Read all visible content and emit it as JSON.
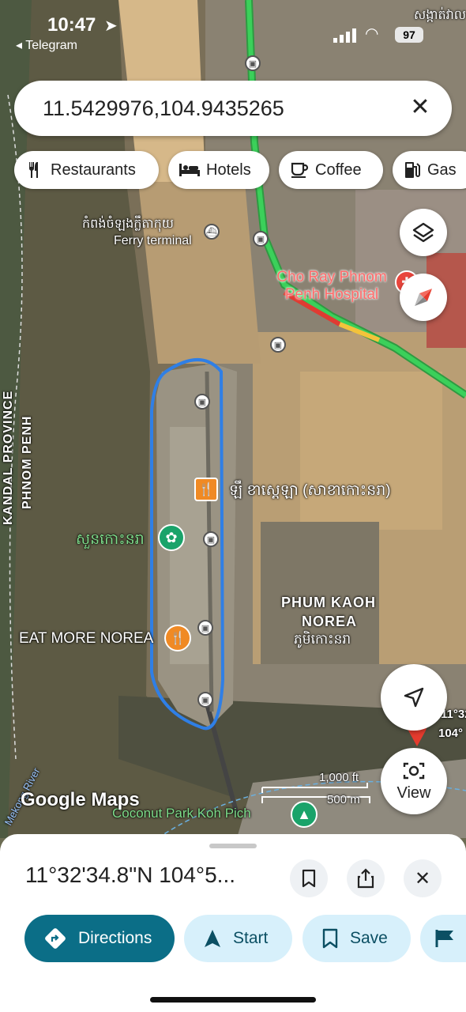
{
  "status_bar": {
    "time": "10:47",
    "back_app": "◂ Telegram",
    "battery": "97",
    "top_right_label": "សង្កាត់វាល"
  },
  "search": {
    "query": "11.5429976,104.9435265"
  },
  "chips": [
    {
      "label": "Restaurants",
      "icon": "fork-knife-icon"
    },
    {
      "label": "Hotels",
      "icon": "bed-icon"
    },
    {
      "label": "Coffee",
      "icon": "coffee-cup-icon"
    },
    {
      "label": "Gas",
      "icon": "gas-pump-icon"
    }
  ],
  "map_labels": {
    "ferry_kh": "កំពង់ចំឡងក្លឹតាកុយ",
    "ferry": "Ferry terminal",
    "hospital": "Cho Ray Phnom Penh Hospital",
    "restaurant_kh": "ឡឹ ខាស្តេឡា (សាខាកោះនរា)",
    "park_kh": "សួនកោះនរា",
    "eat_more": "EAT MORE NOREA",
    "phum_line1": "PHUM KAOH",
    "phum_line2": "NOREA",
    "phum_kh": "ភូមិកោះនរា",
    "province_line1": "KANDAL PROVINCE",
    "province_line2": "PHNOM PENH",
    "river": "Mekong River",
    "coconut_park": "Coconut Park Koh Pich",
    "pin_label_1": "11°32",
    "pin_label_2": "104°",
    "scale_ft": "1,000 ft",
    "scale_m": "500 m",
    "attribution": "Google Maps"
  },
  "view_button": "View",
  "sheet": {
    "coords": "11°32'34.8\"N 104°5..."
  },
  "actions": [
    {
      "label": "Directions",
      "icon": "directions-icon"
    },
    {
      "label": "Start",
      "icon": "navigation-arrow-icon"
    },
    {
      "label": "Save",
      "icon": "bookmark-icon"
    },
    {
      "label": "",
      "icon": "flag-icon"
    }
  ],
  "colors": {
    "directions_bg": "#0b6e87",
    "action_bg": "#d7f0fb",
    "route_outline": "#2f7fe6",
    "traffic_green": "#3bd05a"
  }
}
